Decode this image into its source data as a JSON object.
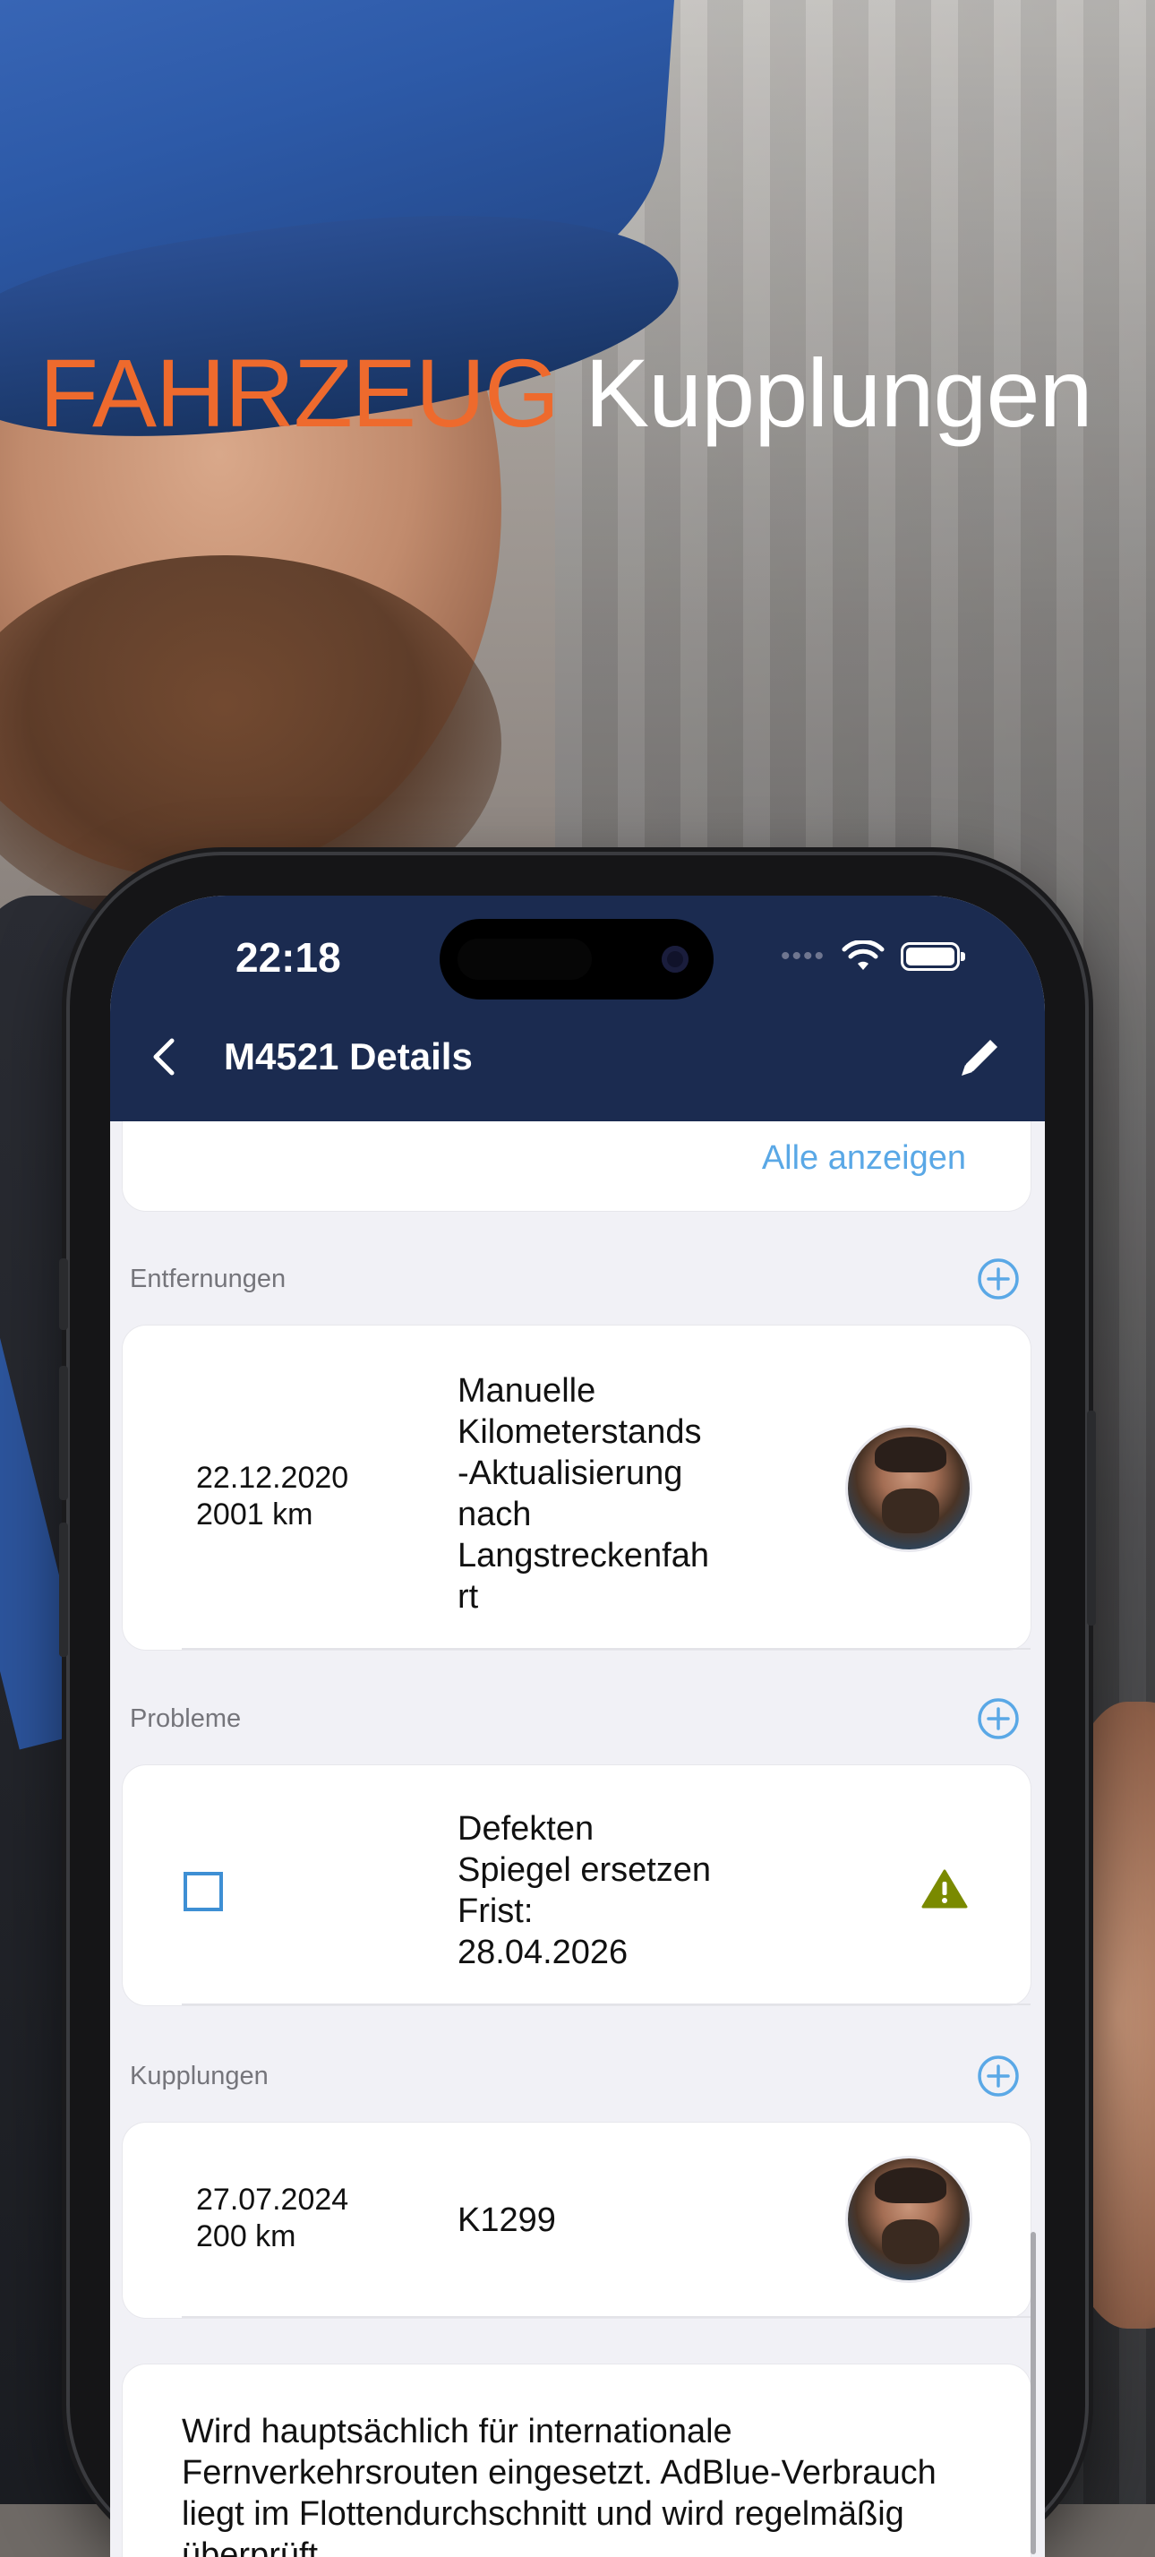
{
  "headline": {
    "accent": "FAHRZEUG",
    "main": "Kupplungen"
  },
  "colors": {
    "accent": "#ee6a2d",
    "nav_bar": "#1b2b50",
    "link": "#5aa8e6",
    "checkbox": "#3e8fd4",
    "warning": "#7a8a00"
  },
  "status_bar": {
    "time": "22:18"
  },
  "nav": {
    "title": "M4521 Details",
    "back_icon": "chevron-left-icon",
    "edit_icon": "pencil-icon"
  },
  "prev_card": {
    "show_all": "Alle anzeigen"
  },
  "sections": {
    "removals": {
      "label": "Entfernungen",
      "item": {
        "date": "22.12.2020",
        "km": "2001 km",
        "description": [
          "Manuelle",
          "Kilometerstands",
          "-Aktualisierung",
          "nach",
          "Langstreckenfah",
          "rt"
        ]
      }
    },
    "problems": {
      "label": "Probleme",
      "item": {
        "lines": [
          "Defekten",
          "Spiegel ersetzen",
          "Frist:",
          "28.04.2026"
        ],
        "checked": false,
        "warning_icon": "warning-triangle-icon"
      }
    },
    "couplings": {
      "label": "Kupplungen",
      "item": {
        "date": "27.07.2024",
        "km": "200 km",
        "code": "K1299"
      }
    }
  },
  "note": {
    "text": "Wird hauptsächlich für internationale Fernverkehrsrouten eingesetzt. AdBlue-Verbrauch liegt im Flottendurchschnitt und wird regelmäßig überprüft."
  }
}
